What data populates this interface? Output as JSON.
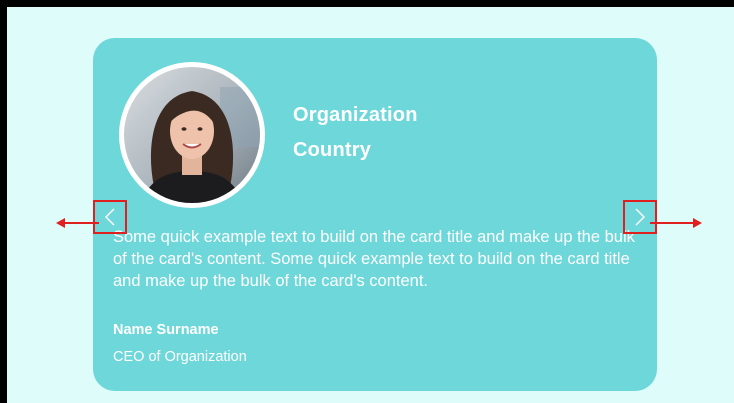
{
  "card": {
    "organization": "Organization",
    "country": "Country",
    "text": "Some quick example text to build on the card title and make up the bulk of the card's content. Some quick example text to build on the card title and make up the bulk of the card's content.",
    "name": "Name Surname",
    "role": "CEO of Organization"
  },
  "carousel": {
    "prev_icon": "chevron-left-icon",
    "next_icon": "chevron-right-icon"
  },
  "colors": {
    "page_background": "#ddfcfa",
    "card_background": "#6dd7da",
    "text": "#ffffff",
    "annotation": "#e02020"
  }
}
